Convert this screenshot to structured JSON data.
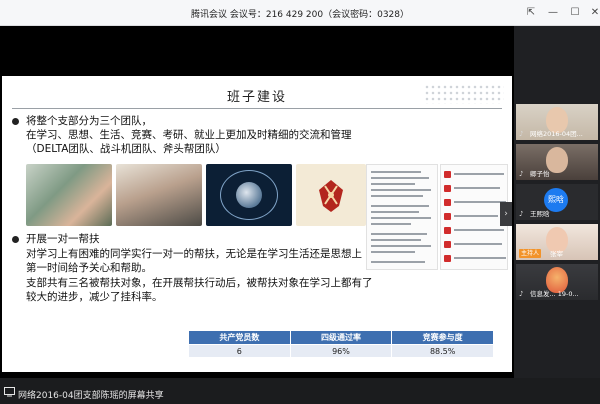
{
  "window": {
    "title": "腾讯会议 会议号：216 429 200（会议密码：0328）"
  },
  "slide": {
    "title": "班子建设",
    "bullet1": {
      "lines": [
        "将整个支部分为三个团队，",
        "在学习、思想、生活、竞赛、考研、就业上更加及时精细的交流和管理",
        "（DELTA团队、战斗机团队、斧头帮团队）"
      ]
    },
    "bullet2": {
      "lines": [
        "开展一对一帮扶",
        "对学习上有困难的同学实行一对一的帮扶，无论是在学习生活还是思想上",
        "第一时间给予关心和帮助。",
        "支部共有三名被帮扶对象，在开展帮扶行动后，被帮扶对象在学习上都有了",
        "较大的进步，减少了挂科率。"
      ]
    },
    "table": {
      "headers": [
        "共产党员数",
        "四级通过率",
        "竞赛参与度"
      ],
      "row": [
        "6",
        "96%",
        "88.5%"
      ]
    }
  },
  "gallery": {
    "participants": [
      {
        "name": "网络2016-04团...",
        "type": "video"
      },
      {
        "name": "卿子怡",
        "type": "video"
      },
      {
        "name": "王熙晗",
        "type": "avatar",
        "avatar_text": "熙晗"
      },
      {
        "name": "张宰",
        "type": "video",
        "badge": "主持人"
      },
      {
        "name": "信息发... 19-0...",
        "type": "video"
      }
    ],
    "colors": {
      "avatar": "#1d7bf0",
      "host_badge": "#f2932a"
    }
  },
  "bottom": {
    "share_label": "网络2016-04团支部陈瑶的屏幕共享"
  },
  "colors": {
    "table_header": "#3e6fb0",
    "table_cell": "#e6ebf4"
  }
}
